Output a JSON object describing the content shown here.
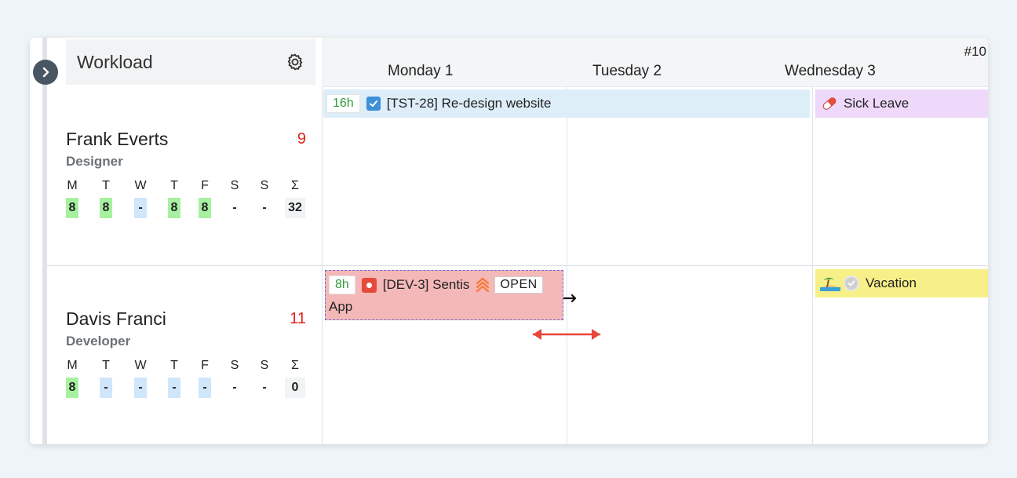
{
  "panel": {
    "title": "Workload",
    "week": "#10"
  },
  "days": [
    "Monday 1",
    "Tuesday 2",
    "Wednesday 3"
  ],
  "weekday_letters": [
    "M",
    "T",
    "W",
    "T",
    "F",
    "S",
    "S",
    "Σ"
  ],
  "people": [
    {
      "name": "Frank Everts",
      "role": "Designer",
      "count": "9",
      "week_values": [
        "8",
        "8",
        "-",
        "8",
        "8",
        "-",
        "-",
        "32"
      ]
    },
    {
      "name": "Davis Franci",
      "role": "Developer",
      "count": "11",
      "week_values": [
        "8",
        "-",
        "-",
        "-",
        "-",
        "-",
        "-",
        "0"
      ]
    }
  ],
  "tasks": [
    {
      "hours": "16h",
      "title": "[TST-28] Re-design website",
      "color": "#ddeef9"
    },
    {
      "hours": "8h",
      "title": "[DEV-3] Sentis",
      "title_cont": "App",
      "status": "OPEN",
      "color": "#f5b8b8"
    }
  ],
  "absences": [
    {
      "label": "Sick Leave",
      "icon": "pill-icon",
      "color": "#efd9fa"
    },
    {
      "label": "Vacation",
      "icon": "beach-icon",
      "color": "#f7f088"
    }
  ],
  "colors": {
    "count_red": "#e0231b",
    "hours_green": "#2e9b3a",
    "day_green": "#a7f0a0",
    "day_blue": "#cfe6fb",
    "resize_arrow": "#e8463a"
  }
}
